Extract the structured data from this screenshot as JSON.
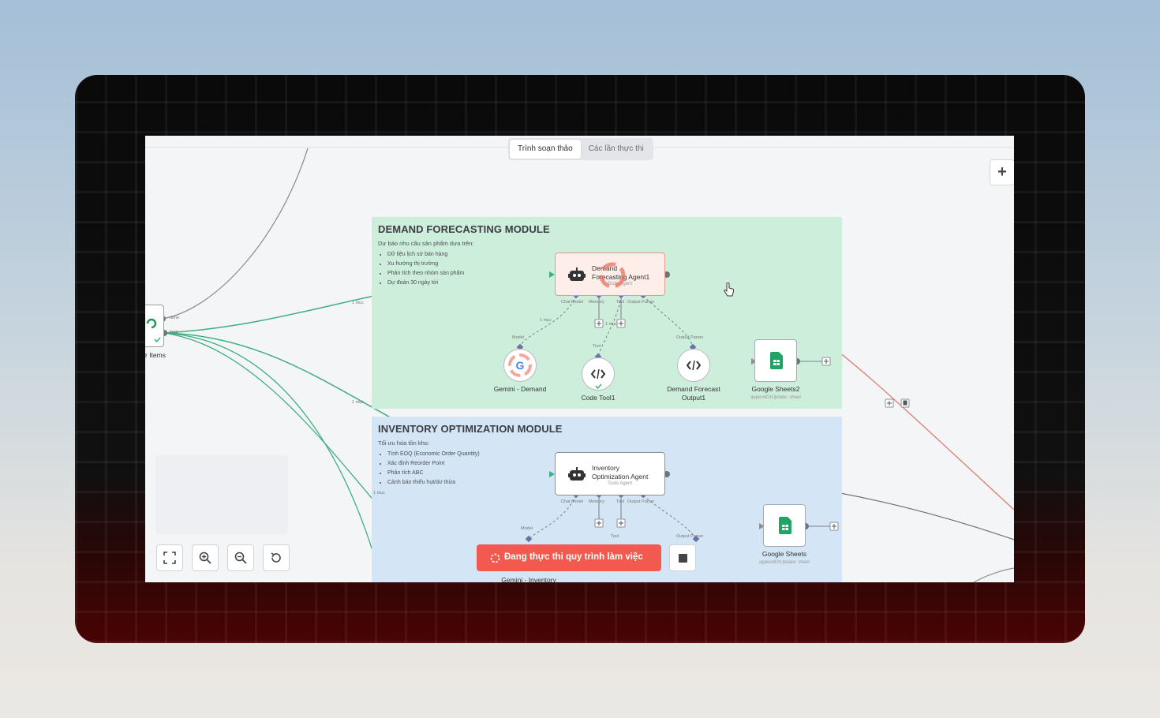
{
  "tabs": [
    {
      "label": "Trình soạn thảo",
      "active": true
    },
    {
      "label": "Các lần thực thi",
      "active": false
    }
  ],
  "demand_module": {
    "title": "DEMAND FORECASTING MODULE",
    "intro": "Dự báo nhu cầu sản phẩm dựa trên:",
    "items": [
      "Dữ liệu lịch sử bán hàng",
      "Xu hướng thị trường",
      "Phân tích theo nhóm sản phẩm",
      "Dự đoán 30 ngày tới"
    ],
    "agent": {
      "name_line1": "Demand",
      "name_line2": "Forecasting Agent1",
      "subtitle": "Tools Agent"
    },
    "ports": {
      "chat_model": "Chat Model",
      "memory": "Memory",
      "tool": "Tool",
      "output_parser": "Output Parser"
    },
    "model_label": "Model",
    "tool_label": "Tool",
    "parser_label": "Output Parser",
    "gemini": {
      "label": "Gemini - Demand"
    },
    "code_tool": {
      "label": "Code Tool1"
    },
    "output_node": {
      "label_line1": "Demand Forecast",
      "label_line2": "Output1"
    },
    "sheets": {
      "label": "Google Sheets2",
      "sub": "appendOrUpdate: sheet"
    },
    "edge_label": "1 mục",
    "model_edge_label": "1 mục",
    "tool_edge_label": "1 mục"
  },
  "inventory_module": {
    "title": "INVENTORY OPTIMIZATION MODULE",
    "intro": "Tối ưu hóa tồn kho:",
    "items": [
      "Tính EOQ (Economic Order Quantity)",
      "Xác định Reorder Point",
      "Phân tích ABC",
      "Cảnh báo thiếu hụt/dư thừa"
    ],
    "agent": {
      "name_line1": "Inventory",
      "name_line2": "Optimization Agent",
      "subtitle": "Tools Agent"
    },
    "ports": {
      "chat_model": "Chat Model",
      "memory": "Memory",
      "tool": "Tool",
      "output_parser": "Output Parser"
    },
    "model_label": "Model",
    "tool_label": "Tool",
    "parser_label": "Output Parser",
    "gemini_label": "Gemini - Inventory",
    "sheets": {
      "label": "Google Sheets",
      "sub": "appendOrUpdate: sheet"
    },
    "edge_label": "1 mục"
  },
  "left_node": {
    "label": "r Items",
    "out_done": "done",
    "out_loop": "loop"
  },
  "edge_labels": {
    "left_mid": "1 mục"
  },
  "run_button": {
    "label": "Đang thực thi quy trình làm việc"
  },
  "icons": {
    "add": "plus-icon",
    "fit": "fit-view-icon",
    "zoom_in": "zoom-in-icon",
    "zoom_out": "zoom-out-icon",
    "reset": "reset-icon",
    "stop": "stop-icon",
    "robot": "robot-icon",
    "code": "code-icon",
    "sheets": "google-sheets-icon",
    "gemini": "google-icon"
  },
  "colors": {
    "success_edge": "#3fae83",
    "running_edge": "#e07b73",
    "run_button": "#f25a4f",
    "demand_bg": "#cdeedb",
    "inventory_bg": "#d4e6f5"
  }
}
